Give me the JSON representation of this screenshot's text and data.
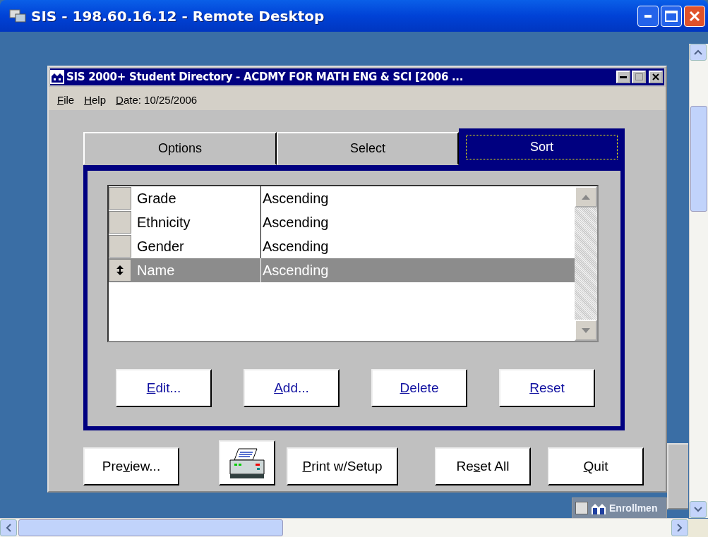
{
  "window": {
    "title": "SIS - 198.60.16.12 - Remote Desktop"
  },
  "dialog": {
    "title": "SIS 2000+  Student Directory - ACDMY FOR MATH ENG & SCI [2006 ...",
    "menu": [
      {
        "key": "F",
        "after": "ile"
      },
      {
        "key": "H",
        "after": "elp"
      },
      {
        "key": "D",
        "after": "ate: 10/25/2006"
      }
    ],
    "tabs": [
      {
        "label": "Options",
        "selected": false
      },
      {
        "label": "Select",
        "selected": false
      },
      {
        "label": "Sort",
        "selected": true
      }
    ],
    "sort_rows": [
      {
        "field": "Grade",
        "order": "Ascending",
        "selected": false
      },
      {
        "field": "Ethnicity",
        "order": "Ascending",
        "selected": false
      },
      {
        "field": "Gender",
        "order": "Ascending",
        "selected": false
      },
      {
        "field": "Name",
        "order": "Ascending",
        "selected": true
      }
    ],
    "list_buttons": [
      {
        "key": "E",
        "after": "dit..."
      },
      {
        "key": "A",
        "after": "dd..."
      },
      {
        "key": "D",
        "after": "elete"
      },
      {
        "key": "R",
        "after": "eset"
      }
    ],
    "bottom_buttons": [
      {
        "kind": "text",
        "before": "Pre",
        "key": "v",
        "after": "iew..."
      },
      {
        "kind": "printer"
      },
      {
        "kind": "text",
        "key": "P",
        "after": "rint w/Setup"
      },
      {
        "kind": "text",
        "before": "Re",
        "key": "s",
        "after": "et All"
      },
      {
        "kind": "text",
        "key": "Q",
        "after": "uit"
      }
    ]
  },
  "background_windows": [
    {
      "title": "Enrollmen"
    }
  ]
}
